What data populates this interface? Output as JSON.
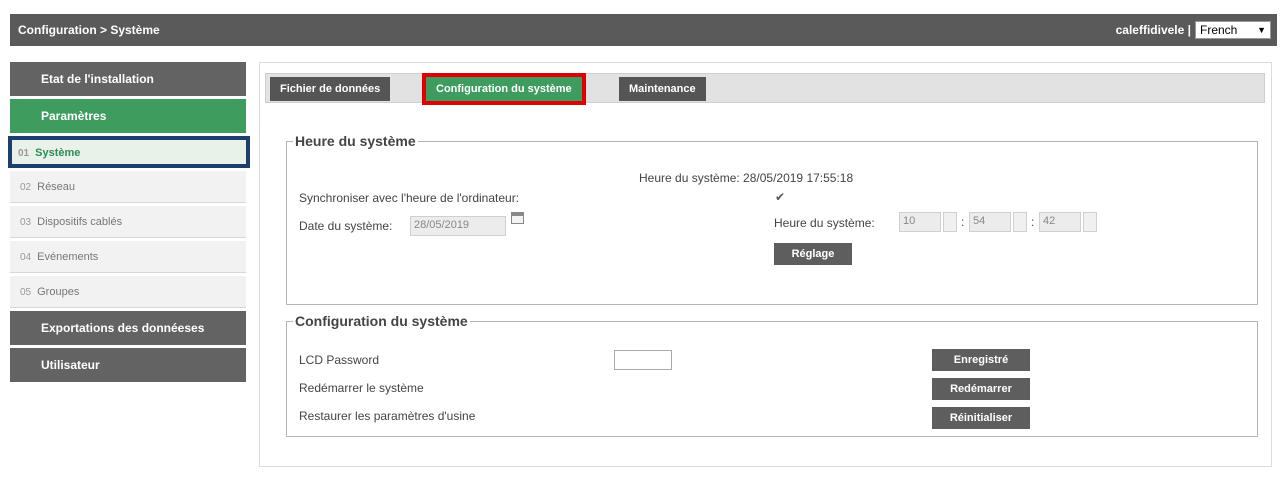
{
  "header": {
    "breadcrumb": "Configuration > Système",
    "user": "caleffidivele |",
    "language": "French"
  },
  "sidebar": {
    "state": "Etat de l'installation",
    "params": "Paramètres",
    "items": [
      {
        "num": "01",
        "label": "Système"
      },
      {
        "num": "02",
        "label": "Réseau"
      },
      {
        "num": "03",
        "label": "Dispositifs cablés"
      },
      {
        "num": "04",
        "label": "Evénements"
      },
      {
        "num": "05",
        "label": "Groupes"
      }
    ],
    "export": "Exportations des donnéeses",
    "user": "Utilisateur"
  },
  "tabs": [
    "Fichier de données",
    "Configuration du système",
    "Maintenance"
  ],
  "heure": {
    "legend": "Heure du système",
    "current_label": "Heure du système: 28/05/2019 17:55:18",
    "sync_label": "Synchroniser avec l'heure de l'ordinateur:",
    "sync_check": "✔",
    "date_label": "Date du système:",
    "date_value": "28/05/2019",
    "time_label": "Heure du système:",
    "hour": "10",
    "sep1": ":",
    "minute": "54",
    "sep2": ":",
    "second": "42",
    "reglage": "Réglage"
  },
  "config": {
    "legend": "Configuration du système",
    "lcd_label": "LCD Password",
    "restart_label": "Redémarrer le système",
    "reset_label": "Restaurer les paramètres d'usine",
    "save_btn": "Enregistré",
    "restart_btn": "Redémarrer",
    "reset_btn": "Réinitialiser"
  },
  "colors": {
    "green": "#3e9c5e",
    "dark": "#5a5a5a",
    "highlight_red": "#e00000",
    "highlight_blue": "#1c3f6e"
  }
}
